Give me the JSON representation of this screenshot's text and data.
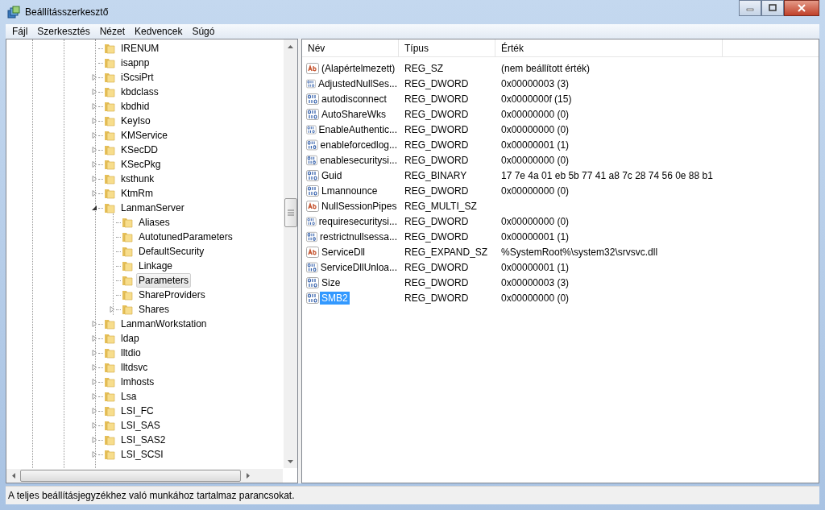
{
  "window": {
    "title": "Beállításszerkesztő"
  },
  "menu": [
    {
      "label": "Fájl"
    },
    {
      "label": "Szerkesztés"
    },
    {
      "label": "Nézet"
    },
    {
      "label": "Kedvencek"
    },
    {
      "label": "Súgó"
    }
  ],
  "tree": [
    {
      "label": "IRENUM",
      "kind": "leaf",
      "selected": false
    },
    {
      "label": "isapnp",
      "kind": "leaf",
      "selected": false
    },
    {
      "label": "iScsiPrt",
      "kind": "collapsed",
      "selected": false
    },
    {
      "label": "kbdclass",
      "kind": "collapsed",
      "selected": false
    },
    {
      "label": "kbdhid",
      "kind": "collapsed",
      "selected": false
    },
    {
      "label": "KeyIso",
      "kind": "collapsed",
      "selected": false
    },
    {
      "label": "KMService",
      "kind": "collapsed",
      "selected": false
    },
    {
      "label": "KSecDD",
      "kind": "collapsed",
      "selected": false
    },
    {
      "label": "KSecPkg",
      "kind": "collapsed",
      "selected": false
    },
    {
      "label": "ksthunk",
      "kind": "collapsed",
      "selected": false
    },
    {
      "label": "KtmRm",
      "kind": "collapsed",
      "selected": false
    },
    {
      "label": "LanmanServer",
      "kind": "expanded",
      "selected": false,
      "children": [
        {
          "label": "Aliases",
          "kind": "leaf",
          "selected": false
        },
        {
          "label": "AutotunedParameters",
          "kind": "leaf",
          "selected": false
        },
        {
          "label": "DefaultSecurity",
          "kind": "leaf",
          "selected": false
        },
        {
          "label": "Linkage",
          "kind": "leaf",
          "selected": false
        },
        {
          "label": "Parameters",
          "kind": "leaf",
          "selected": true
        },
        {
          "label": "ShareProviders",
          "kind": "leaf",
          "selected": false
        },
        {
          "label": "Shares",
          "kind": "collapsed",
          "selected": false
        }
      ]
    },
    {
      "label": "LanmanWorkstation",
      "kind": "collapsed",
      "selected": false
    },
    {
      "label": "ldap",
      "kind": "collapsed",
      "selected": false
    },
    {
      "label": "lltdio",
      "kind": "collapsed",
      "selected": false
    },
    {
      "label": "lltdsvc",
      "kind": "collapsed",
      "selected": false
    },
    {
      "label": "lmhosts",
      "kind": "collapsed",
      "selected": false
    },
    {
      "label": "Lsa",
      "kind": "collapsed",
      "selected": false
    },
    {
      "label": "LSI_FC",
      "kind": "collapsed",
      "selected": false
    },
    {
      "label": "LSI_SAS",
      "kind": "collapsed",
      "selected": false
    },
    {
      "label": "LSI_SAS2",
      "kind": "collapsed",
      "selected": false
    },
    {
      "label": "LSI_SCSI",
      "kind": "collapsed",
      "selected": false
    }
  ],
  "values": {
    "columns": [
      "Név",
      "Típus",
      "Érték"
    ],
    "rows": [
      {
        "kind": "string",
        "name": "(Alapértelmezett)",
        "type": "REG_SZ",
        "data": "(nem beállított érték)",
        "selected": false
      },
      {
        "kind": "binary",
        "name": "AdjustedNullSes...",
        "type": "REG_DWORD",
        "data": "0x00000003 (3)",
        "selected": false
      },
      {
        "kind": "binary",
        "name": "autodisconnect",
        "type": "REG_DWORD",
        "data": "0x0000000f (15)",
        "selected": false
      },
      {
        "kind": "binary",
        "name": "AutoShareWks",
        "type": "REG_DWORD",
        "data": "0x00000000 (0)",
        "selected": false
      },
      {
        "kind": "binary",
        "name": "EnableAuthentic...",
        "type": "REG_DWORD",
        "data": "0x00000000 (0)",
        "selected": false
      },
      {
        "kind": "binary",
        "name": "enableforcedlog...",
        "type": "REG_DWORD",
        "data": "0x00000001 (1)",
        "selected": false
      },
      {
        "kind": "binary",
        "name": "enablesecuritysi...",
        "type": "REG_DWORD",
        "data": "0x00000000 (0)",
        "selected": false
      },
      {
        "kind": "binary",
        "name": "Guid",
        "type": "REG_BINARY",
        "data": "17 7e 4a 01 eb 5b 77 41 a8 7c 28 74 56 0e 88 b1",
        "selected": false
      },
      {
        "kind": "binary",
        "name": "Lmannounce",
        "type": "REG_DWORD",
        "data": "0x00000000 (0)",
        "selected": false
      },
      {
        "kind": "string",
        "name": "NullSessionPipes",
        "type": "REG_MULTI_SZ",
        "selected": false
      },
      {
        "kind": "binary",
        "name": "requiresecuritysi...",
        "type": "REG_DWORD",
        "data": "0x00000000 (0)",
        "selected": false
      },
      {
        "kind": "binary",
        "name": "restrictnullsessa...",
        "type": "REG_DWORD",
        "data": "0x00000001 (1)",
        "selected": false
      },
      {
        "kind": "string",
        "name": "ServiceDll",
        "type": "REG_EXPAND_SZ",
        "data": "%SystemRoot%\\system32\\srvsvc.dll",
        "selected": false
      },
      {
        "kind": "binary",
        "name": "ServiceDllUnloa...",
        "type": "REG_DWORD",
        "data": "0x00000001 (1)",
        "selected": false
      },
      {
        "kind": "binary",
        "name": "Size",
        "type": "REG_DWORD",
        "data": "0x00000003 (3)",
        "selected": false
      },
      {
        "kind": "binary",
        "name": "SMB2",
        "type": "REG_DWORD",
        "data": "0x00000000 (0)",
        "selected": true
      }
    ]
  },
  "status_bar": "A teljes beállításjegyzékhez való munkához tartalmaz parancsokat."
}
